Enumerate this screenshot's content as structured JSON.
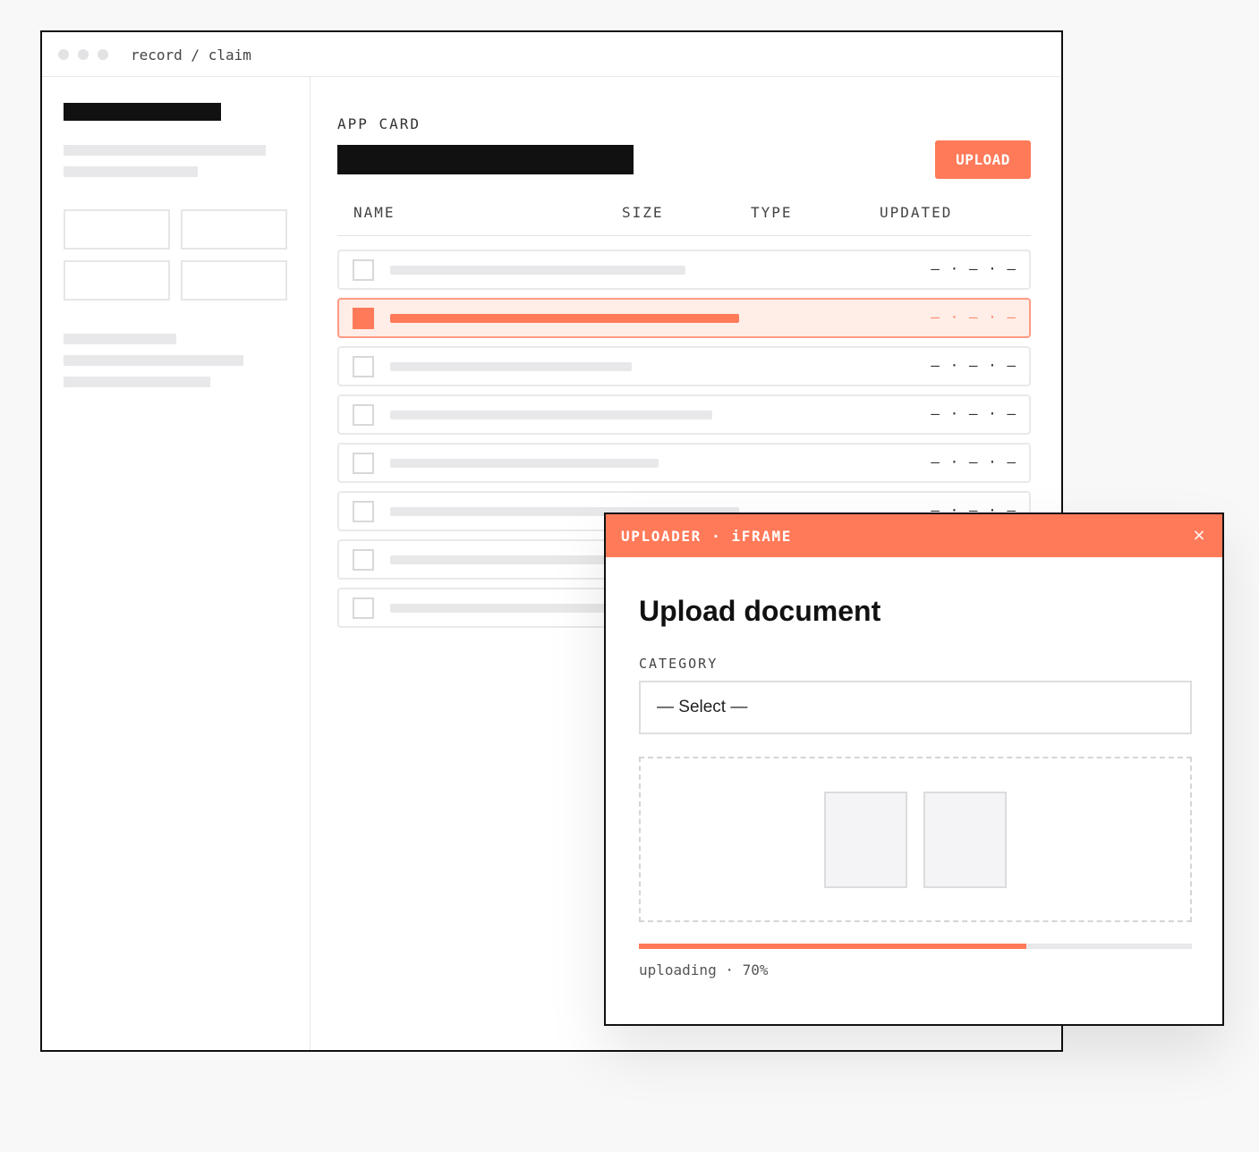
{
  "window": {
    "breadcrumb": "record / claim"
  },
  "main": {
    "section_label": "APP CARD",
    "upload_label": "UPLOAD",
    "columns": [
      "NAME",
      "SIZE",
      "TYPE",
      "UPDATED"
    ],
    "row_placeholder": "— · — · —",
    "selected_row_index": 1
  },
  "modal": {
    "title": "UPLOADER · iFRAME",
    "close_glyph": "×",
    "heading": "Upload document",
    "category_label": "CATEGORY",
    "select_value": "— Select —",
    "progress_percent": 70,
    "progress_text": "uploading · 70%"
  },
  "colors": {
    "accent": "#ff7a59",
    "selected_row_bg": "#ffede7"
  }
}
